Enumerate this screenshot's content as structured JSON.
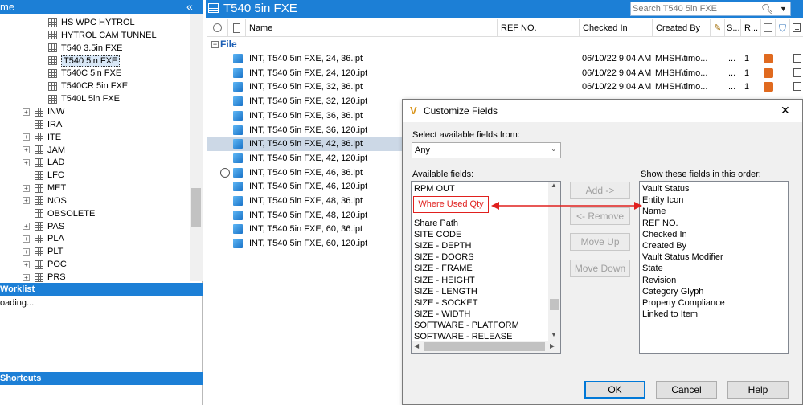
{
  "left_panel": {
    "title": "me",
    "collapse_glyph": "«",
    "tree": [
      {
        "label": "HS WPC HYTROL",
        "plus": false,
        "indent": 2
      },
      {
        "label": "HYTROL CAM TUNNEL",
        "plus": false,
        "indent": 2
      },
      {
        "label": "T540 3.5in FXE",
        "plus": false,
        "indent": 2
      },
      {
        "label": "T540 5in FXE",
        "plus": false,
        "indent": 2,
        "selected": true
      },
      {
        "label": "T540C 5in FXE",
        "plus": false,
        "indent": 2
      },
      {
        "label": "T540CR 5in FXE",
        "plus": false,
        "indent": 2
      },
      {
        "label": "T540L 5in FXE",
        "plus": false,
        "indent": 2
      },
      {
        "label": "INW",
        "plus": true,
        "indent": 1
      },
      {
        "label": "IRA",
        "plus": false,
        "indent": 1
      },
      {
        "label": "ITE",
        "plus": true,
        "indent": 1
      },
      {
        "label": "JAM",
        "plus": true,
        "indent": 1
      },
      {
        "label": "LAD",
        "plus": true,
        "indent": 1
      },
      {
        "label": "LFC",
        "plus": false,
        "indent": 1
      },
      {
        "label": "MET",
        "plus": true,
        "indent": 1
      },
      {
        "label": "NOS",
        "plus": true,
        "indent": 1
      },
      {
        "label": "OBSOLETE",
        "plus": false,
        "indent": 1
      },
      {
        "label": "PAS",
        "plus": true,
        "indent": 1
      },
      {
        "label": "PLA",
        "plus": true,
        "indent": 1
      },
      {
        "label": "PLT",
        "plus": true,
        "indent": 1
      },
      {
        "label": "POC",
        "plus": true,
        "indent": 1
      },
      {
        "label": "PRS",
        "plus": true,
        "indent": 1
      }
    ],
    "worklist_title": "Worklist",
    "worklist_status": "oading...",
    "shortcuts_title": "Shortcuts"
  },
  "main": {
    "title": "T540 5in FXE",
    "search_placeholder": "Search T540 5in FXE",
    "columns": {
      "name": "Name",
      "ref": "REF NO.",
      "checked_in": "Checked In",
      "created_by": "Created By",
      "state": "S...",
      "revision": "R..."
    },
    "group_label": "File",
    "rows": [
      {
        "name": "INT, T540 5in FXE, 24, 36.ipt",
        "checked_in": "06/10/22 9:04 AM",
        "created_by": "MHSH\\timo...",
        "state": "...",
        "rev": "1"
      },
      {
        "name": "INT, T540 5in FXE, 24, 120.ipt",
        "checked_in": "06/10/22 9:04 AM",
        "created_by": "MHSH\\timo...",
        "state": "...",
        "rev": "1"
      },
      {
        "name": "INT, T540 5in FXE, 32, 36.ipt",
        "checked_in": "06/10/22 9:04 AM",
        "created_by": "MHSH\\timo...",
        "state": "...",
        "rev": "1"
      },
      {
        "name": "INT, T540 5in FXE, 32, 120.ipt"
      },
      {
        "name": "INT, T540 5in FXE, 36, 36.ipt"
      },
      {
        "name": "INT, T540 5in FXE, 36, 120.ipt"
      },
      {
        "name": "INT, T540 5in FXE, 42, 36.ipt",
        "selected": true
      },
      {
        "name": "INT, T540 5in FXE, 42, 120.ipt"
      },
      {
        "name": "INT, T540 5in FXE, 46, 36.ipt",
        "radio": true
      },
      {
        "name": "INT, T540 5in FXE, 46, 120.ipt"
      },
      {
        "name": "INT, T540 5in FXE, 48, 36.ipt"
      },
      {
        "name": "INT, T540 5in FXE, 48, 120.ipt"
      },
      {
        "name": "INT, T540 5in FXE, 60, 36.ipt"
      },
      {
        "name": "INT, T540 5in FXE, 60, 120.ipt"
      }
    ]
  },
  "dialog": {
    "title": "Customize Fields",
    "close_glyph": "✕",
    "select_label": "Select available fields from:",
    "select_value": "Any",
    "available_label": "Available fields:",
    "available": [
      "RPM OUT",
      "",
      "",
      "Share Path",
      "SITE CODE",
      "SIZE - DEPTH",
      "SIZE - DOORS",
      "SIZE - FRAME",
      "SIZE - HEIGHT",
      "SIZE - LENGTH",
      "SIZE - SOCKET",
      "SIZE - WIDTH",
      "SOFTWARE - PLATFORM",
      "SOFTWARE - RELEASE"
    ],
    "callout": "Where Used Qty",
    "buttons": {
      "add": "Add ->",
      "remove": "<- Remove",
      "move_up": "Move Up",
      "move_down": "Move Down",
      "ok": "OK",
      "cancel": "Cancel",
      "help": "Help"
    },
    "order_label": "Show these fields in this order:",
    "order": [
      "Vault Status",
      "Entity Icon",
      "Name",
      "REF NO.",
      "Checked In",
      "Created By",
      "Vault Status Modifier",
      "State",
      "Revision",
      "Category Glyph",
      "Property Compliance",
      "Linked to Item"
    ]
  },
  "colors": {
    "accent": "#1c7fd6",
    "status_orange": "#e06a1f",
    "callout_red": "#e0201e"
  }
}
